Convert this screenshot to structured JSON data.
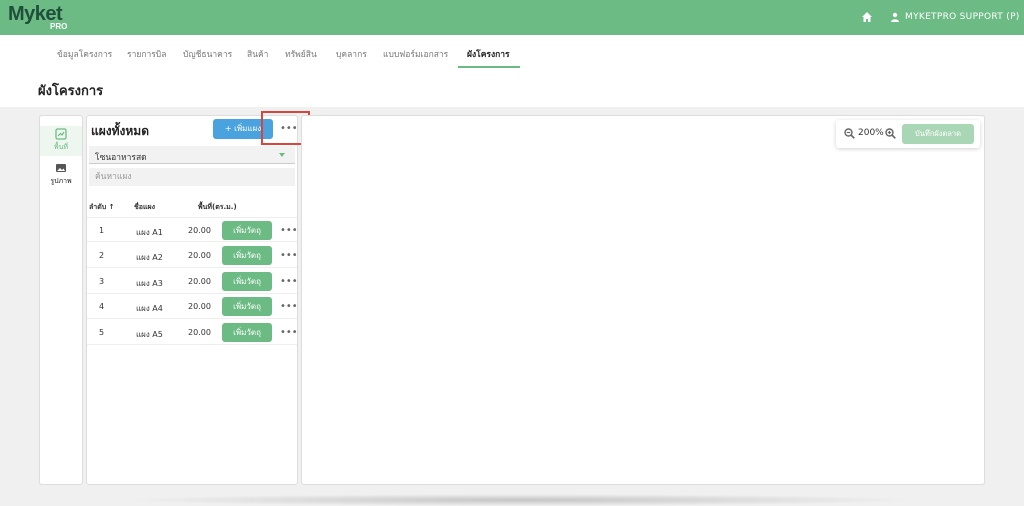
{
  "brand": {
    "logo_main": "Myket",
    "logo_sub": "PRO"
  },
  "header": {
    "user_name": "MYKETPRO SUPPORT (P)"
  },
  "tabs": [
    {
      "label": "ข้อมูลโครงการ"
    },
    {
      "label": "รายการบิล"
    },
    {
      "label": "บัญชีธนาคาร"
    },
    {
      "label": "สินค้า"
    },
    {
      "label": "ทรัพย์สิน"
    },
    {
      "label": "บุคลากร"
    },
    {
      "label": "แบบฟอร์มเอกสาร"
    },
    {
      "label": "ผังโครงการ"
    }
  ],
  "page": {
    "title": "ผังโครงการ"
  },
  "side_nav": [
    {
      "label": "พื้นที่",
      "icon": "area-icon"
    },
    {
      "label": "รูปภาพ",
      "icon": "image-icon"
    }
  ],
  "panel": {
    "title": "แผงทั้งหมด",
    "add_label": "+ เพิ่มแผง",
    "more": "•••",
    "zone_select": "โซนอาหารสด",
    "search_placeholder": "ค้นหาแผง",
    "columns": {
      "order": "ลำดับ ↑",
      "name": "ชื่อแผง",
      "area": "พื้นที่(ตร.ม.)"
    },
    "rows": [
      {
        "order": "1",
        "name": "แผง A1",
        "area": "20.00",
        "action": "เพิ่มวัตถุ",
        "more": "•••"
      },
      {
        "order": "2",
        "name": "แผง A2",
        "area": "20.00",
        "action": "เพิ่มวัตถุ",
        "more": "•••"
      },
      {
        "order": "3",
        "name": "แผง A3",
        "area": "20.00",
        "action": "เพิ่มวัตถุ",
        "more": "•••"
      },
      {
        "order": "4",
        "name": "แผง A4",
        "area": "20.00",
        "action": "เพิ่มวัตถุ",
        "more": "•••"
      },
      {
        "order": "5",
        "name": "แผง A5",
        "area": "20.00",
        "action": "เพิ่มวัตถุ",
        "more": "•••"
      }
    ]
  },
  "canvas": {
    "zoom": "200%",
    "save_label": "บันทึกผังตลาด"
  },
  "colors": {
    "brand_green": "#6cbb84",
    "blue": "#4aa3df",
    "highlight_red": "#d9453c"
  }
}
